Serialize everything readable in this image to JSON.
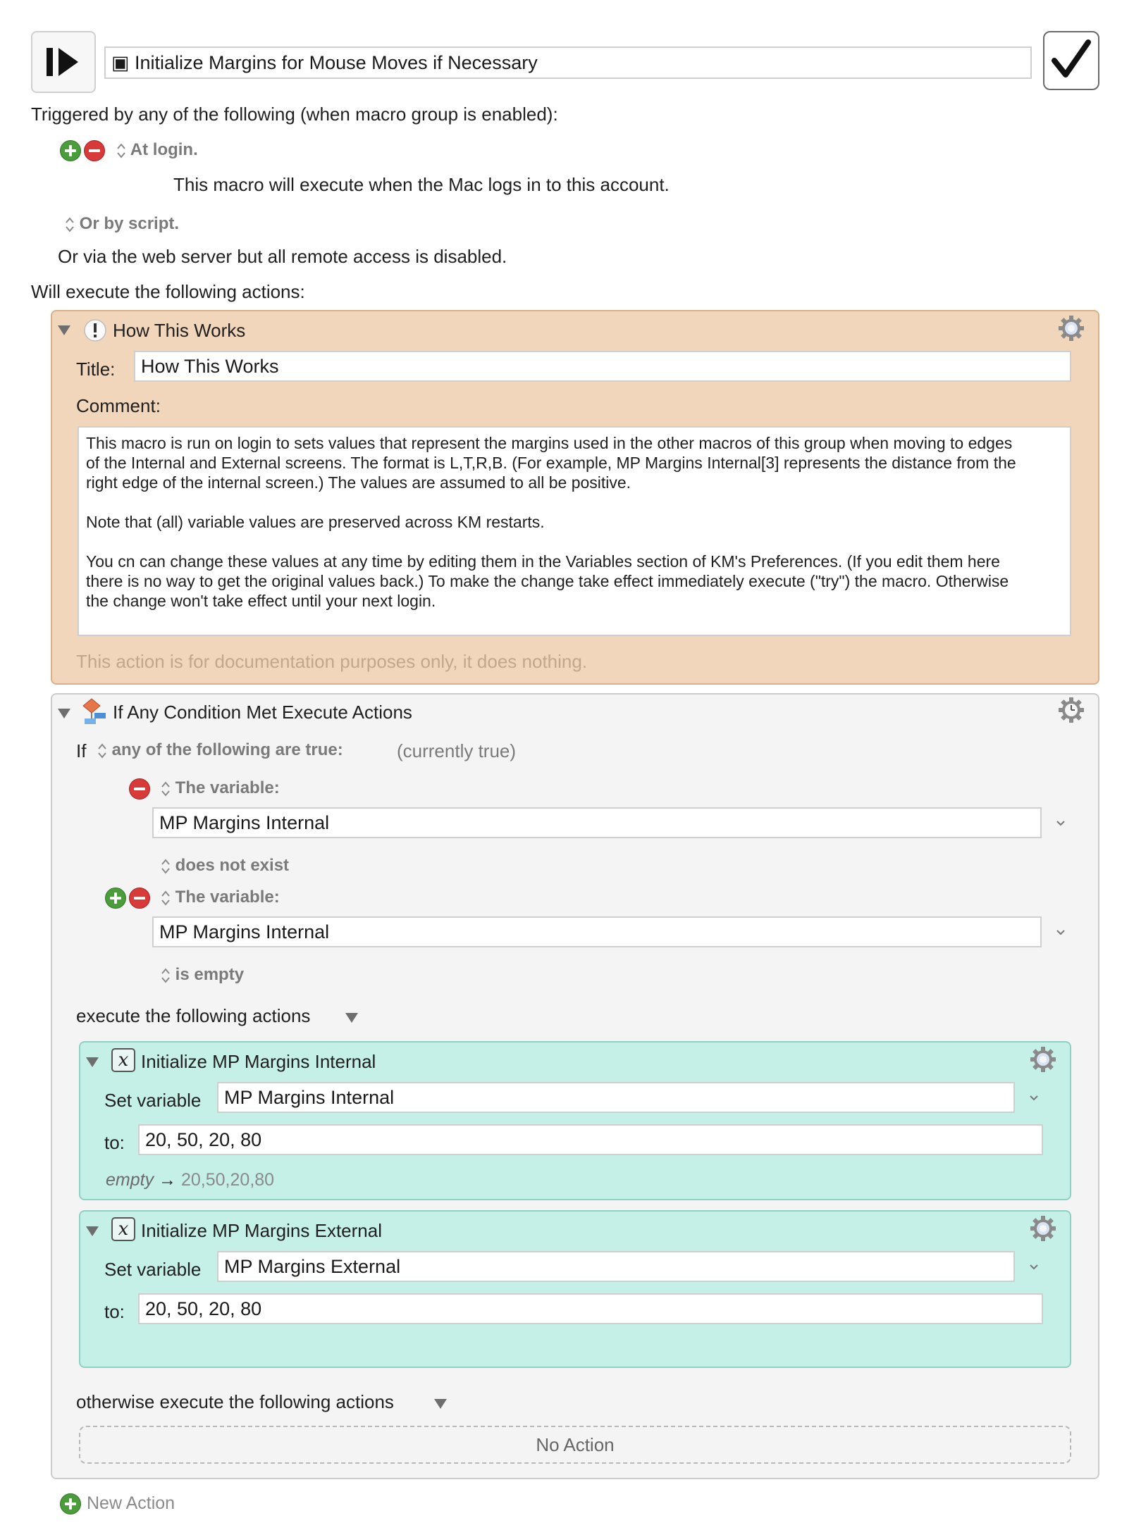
{
  "macro": {
    "name": "▣ Initialize Margins for Mouse Moves if Necessary",
    "enabled": true
  },
  "triggers": {
    "heading": "Triggered by any of the following (when macro group is enabled):",
    "login_label": "At login.",
    "login_desc": "This macro will execute when the Mac logs in to this account.",
    "script_label": "Or by script.",
    "web_note": "Or via the web server but all remote access is disabled."
  },
  "actions_heading": "Will execute the following actions:",
  "comment_action": {
    "header": "How This Works",
    "title_label": "Title:",
    "title_value": "How This Works",
    "comment_label": "Comment:",
    "comment_text": "This macro is run on login to sets values that represent the margins used in the other macros of this group when moving to edges\nof the Internal and External screens. The format is L,T,R,B. (For example, MP Margins Internal[3] represents the distance from the\nright edge of the internal screen.) The values are assumed to all be positive.\n\nNote that (all) variable values are preserved across KM restarts.\n\nYou cn can change these values at any time by editing them in the Variables section of KM's Preferences. (If you edit them here\nthere is no way to get the original values back.) To make the change take effect immediately execute (\"try\") the macro. Otherwise\nthe change won't take effect until your next login.",
    "footer": "This action is for documentation purposes only, it does nothing."
  },
  "if_action": {
    "header": "If Any Condition Met Execute Actions",
    "if_label": "If",
    "any_label": "any of the following are true:",
    "status": "(currently true)",
    "cond1_label": "The variable:",
    "cond1_var": "MP Margins Internal",
    "cond1_test": "does not exist",
    "cond2_label": "The variable:",
    "cond2_var": "MP Margins Internal",
    "cond2_test": "is empty",
    "then_label": "execute the following actions",
    "else_label": "otherwise execute the following actions",
    "no_action": "No Action"
  },
  "set1": {
    "header": "Initialize MP Margins Internal",
    "set_label": "Set variable",
    "var": "MP Margins Internal",
    "to_label": "to:",
    "value": "20, 50, 20, 80",
    "preview_old": "empty",
    "preview_new": "20,50,20,80"
  },
  "set2": {
    "header": "Initialize MP Margins External",
    "set_label": "Set variable",
    "var": "MP Margins External",
    "to_label": "to:",
    "value": "20, 50, 20, 80"
  },
  "new_action": "New Action",
  "colors": {
    "comment_bg": "#f2d6bb",
    "comment_border": "#d9b08c",
    "if_bg": "#f4f4f4",
    "set_bg": "#c4f0e8",
    "set_border": "#8fd1c4",
    "plus": "#4a9d3a",
    "minus": "#d83a3a"
  }
}
